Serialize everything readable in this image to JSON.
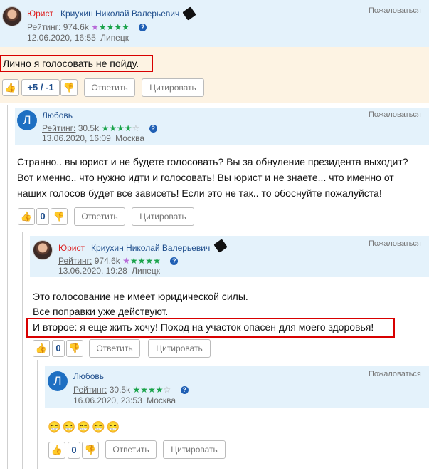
{
  "comments": [
    {
      "role": "Юрист",
      "author": "Криухин Николай Валерьевич",
      "rating_label": "Рейтинг:",
      "rating_value": "974.6k",
      "stars_purple": "★",
      "stars_green": "★★★★",
      "stars_empty": "",
      "date": "12.06.2020, 16:55",
      "city": "Липецк",
      "complain": "Пожаловаться",
      "lines": [
        "Лично я голосовать не пойду."
      ],
      "votes": "+5 / -1",
      "reply": "Ответить",
      "quote": "Цитировать"
    },
    {
      "avatar_letter": "Л",
      "author": "Любовь",
      "rating_label": "Рейтинг:",
      "rating_value": "30.5k",
      "stars_green": "★★★★",
      "stars_empty": "☆",
      "date": "13.06.2020, 16:09",
      "city": "Москва",
      "complain": "Пожаловаться",
      "lines": [
        "Странно.. вы юрист и не будете голосовать? Вы за обнуление президента выходит?",
        "Вот именно.. что нужно идти и голосовать! Вы юрист и не знаете... что именно от",
        "наших голосов будет все зависеть! Если это не так.. то обоснуйте пожалуйста!"
      ],
      "votes": "0",
      "reply": "Ответить",
      "quote": "Цитировать"
    },
    {
      "role": "Юрист",
      "author": "Криухин Николай Валерьевич",
      "rating_label": "Рейтинг:",
      "rating_value": "974.6k",
      "stars_purple": "★",
      "stars_green": "★★★★",
      "stars_empty": "",
      "date": "13.06.2020, 19:28",
      "city": "Липецк",
      "complain": "Пожаловаться",
      "lines": [
        "Это голосование не имеет юридической силы.",
        "Все поправки уже действуют.",
        "И второе: я еще жить хочу! Поход на участок опасен для моего здоровья!"
      ],
      "votes": "0",
      "reply": "Ответить",
      "quote": "Цитировать"
    },
    {
      "avatar_letter": "Л",
      "author": "Любовь",
      "rating_label": "Рейтинг:",
      "rating_value": "30.5k",
      "stars_green": "★★★★",
      "stars_empty": "☆",
      "date": "16.06.2020, 23:53",
      "city": "Москва",
      "complain": "Пожаловаться",
      "lines": [
        "😁😁😁😁😁"
      ],
      "votes": "0",
      "reply": "Ответить",
      "quote": "Цитировать"
    }
  ],
  "icons": {
    "thumb_up": "thumbs-up-icon",
    "thumb_down": "thumbs-down-icon",
    "help": "question-icon",
    "lawyer_badge": "lawyer-badge-icon"
  },
  "colors": {
    "header_bg": "#e4f2fb",
    "highlight_bg": "#fdf3e3",
    "role_red": "#dd2222",
    "name_blue": "#1f4e8c",
    "star_green": "#1aa34a",
    "star_purple": "#b86ad8",
    "vote_orange": "#f0a000",
    "annotation_red": "#d80000"
  }
}
